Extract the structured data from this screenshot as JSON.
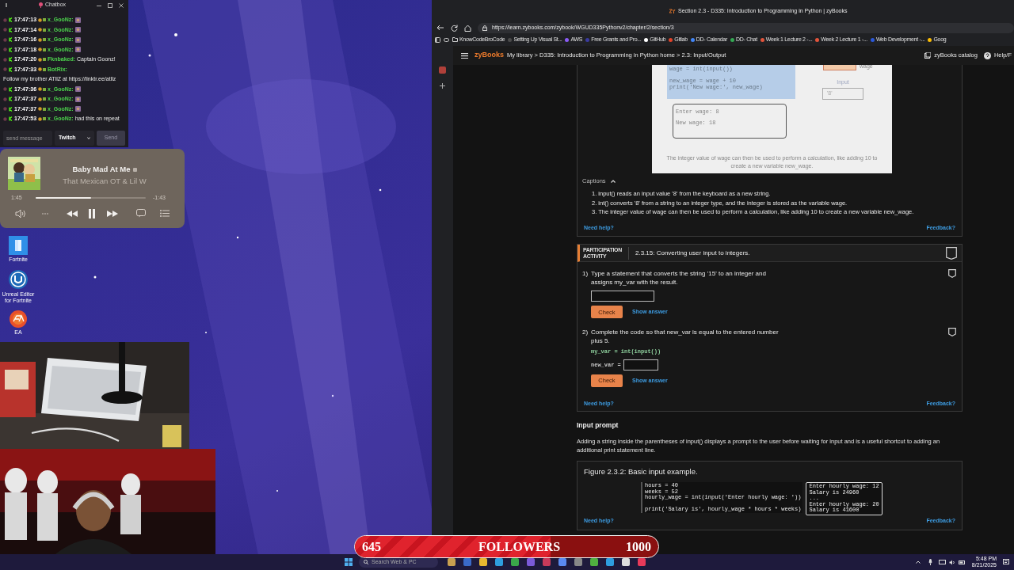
{
  "chat": {
    "title": "Chatbox",
    "messages": [
      {
        "time": "17:47:13",
        "user": "x_GooNz:",
        "emote": true
      },
      {
        "time": "17:47:14",
        "user": "x_GooNz:",
        "emote": true
      },
      {
        "time": "17:47:16",
        "user": "x_GooNz:",
        "emote": true
      },
      {
        "time": "17:47:18",
        "user": "x_GooNz:",
        "emote": true
      },
      {
        "time": "17:47:20",
        "user": "Fknbaked:",
        "text": "Captain Goonz!",
        "emote": false
      },
      {
        "time": "17:47:33",
        "user": "BotRix:",
        "text": "Follow my brother ATllZ at https://linktr.ee/atllz",
        "emote": false
      },
      {
        "time": "17:47:36",
        "user": "x_GooNz:",
        "emote": true
      },
      {
        "time": "17:47:37",
        "user": "x_GooNz:",
        "emote": true
      },
      {
        "time": "17:47:37",
        "user": "x_GooNz:",
        "emote": true
      },
      {
        "time": "17:47:53",
        "user": "x_GooNz:",
        "text": "had this on repeat",
        "emote": false
      }
    ],
    "input": {
      "placeholder": "send message"
    },
    "platform": "Twitch",
    "send_button": "Send"
  },
  "music": {
    "title": "Baby Mad At Me",
    "artist": "That Mexican OT & Lil W",
    "elapsed": "1:45",
    "remaining": "-1:43",
    "level": 0.5,
    "playing": true
  },
  "desktop_icons": [
    {
      "label": "Fortnite",
      "kind": "fortnite"
    },
    {
      "label": "Unreal Editor for Fortnite",
      "kind": "unreal"
    },
    {
      "label": "EA",
      "kind": "ea"
    }
  ],
  "browser": {
    "tab_title": "Section 2.3 - D335: Introduction to Programming in Python | zyBooks",
    "url": "https://learn.zybooks.com/zybook/WGUD335Pythonv2/chapter/2/section/3",
    "bookmarks": [
      {
        "label": "KnowCodeBroCode",
        "kind": "folder"
      },
      {
        "label": "Setting Up Visual St...",
        "kind": "site",
        "color": "#4a4a4a"
      },
      {
        "label": "AWS",
        "kind": "site",
        "color": "#8b5cf6"
      },
      {
        "label": "Free Grants and Pro...",
        "kind": "site",
        "color": "#3b3b9f"
      },
      {
        "label": "GitHub",
        "kind": "site",
        "color": "#ffffff"
      },
      {
        "label": "Gitlab",
        "kind": "site",
        "color": "#e24329"
      },
      {
        "label": "DD- Calendar",
        "kind": "site",
        "color": "#4285f4"
      },
      {
        "label": "DD- Chat",
        "kind": "site",
        "color": "#34a853"
      },
      {
        "label": "Week 1 Lecture 2 -...",
        "kind": "site",
        "color": "#e2543b"
      },
      {
        "label": "Week 2 Lecture 1 -...",
        "kind": "site",
        "color": "#e2543b"
      },
      {
        "label": "Web Development -...",
        "kind": "site",
        "color": "#2b58d8"
      },
      {
        "label": "Goog",
        "kind": "site",
        "color": "#fbbc05"
      }
    ]
  },
  "zybooks": {
    "logo": "zyBooks",
    "breadcrumb": "My library > D335: Introduction to Programming in Python home > 2.3: Input/Output",
    "catalog": "zyBooks catalog",
    "help": "Help/F",
    "animation": {
      "code_lines": [
        {
          "text": "wage = int(input())",
          "gap_before": false
        },
        {
          "text": "new_wage = wage + 10",
          "gap_before": true
        },
        {
          "text": "print('New wage:', new_wage)",
          "gap_before": false
        }
      ],
      "output_lines": [
        "Enter wage: 8",
        "New wage: 18"
      ],
      "memory_label": "wage",
      "input_label": "Input",
      "input_value": "'8'",
      "caption": "The integer value of wage can then be used to perform a calculation, like adding 10 to create a new variable new_wage."
    },
    "captions": {
      "label": "Captions",
      "expanded": true,
      "items": [
        "1. input() reads an input value '8' from the keyboard as a new string.",
        "2. int() converts '8' from a string to an integer type, and the integer is stored as the variable wage.",
        "3. The integer value of wage can then be used to perform a calculation, like adding 10 to create a new variable new_wage."
      ],
      "need_help": "Need help?",
      "feedback": "Feedback?"
    },
    "activity": {
      "label_lines": [
        "PARTICIPATION",
        "ACTIVITY"
      ],
      "title": "2.3.15: Converting user input to integers.",
      "completed": false,
      "questions": [
        {
          "number": "1)",
          "kind": "statement",
          "prompt": "Type a statement that converts the string '15' to an integer and assigns my_var with the result.",
          "completed": false,
          "check": "Check",
          "show_answer": "Show answer"
        },
        {
          "number": "2)",
          "kind": "code",
          "prompt": "Complete the code so that new_var is equal to the entered number plus 5.",
          "code_line": "my_var = int(input())",
          "blank_prefix": "new_var =",
          "completed": false,
          "check": "Check",
          "show_answer": "Show answer"
        }
      ],
      "need_help": "Need help?",
      "feedback": "Feedback?"
    },
    "section": {
      "heading": "Input prompt",
      "paragraph": "Adding a string inside the parentheses of input() displays a prompt to the user before waiting for input and is a useful shortcut to adding an additional print statement line.",
      "figure": {
        "caption": "Figure 2.3.2: Basic input example.",
        "code_lines": [
          {
            "text": "hours = 40",
            "gap_before": false
          },
          {
            "text": "weeks = 52",
            "gap_before": false
          },
          {
            "text": "hourly_wage = int(input('Enter hourly wage: '))",
            "gap_before": false
          },
          {
            "text": "print('Salary is', hourly_wage * hours * weeks)",
            "gap_before": true
          }
        ],
        "output_lines": [
          "Enter hourly wage: 12",
          "Salary is 24960",
          "...",
          "Enter hourly wage: 20",
          "Salary is 41600"
        ],
        "need_help": "Need help?",
        "feedback": "Feedback?"
      }
    }
  },
  "followers": {
    "count": "645",
    "label": "FOLLOWERS",
    "goal": "1000",
    "level": 0.645
  },
  "taskbar": {
    "search_placeholder": "Search Web & PC",
    "time": "5:48 PM",
    "date": "8/21/2025"
  }
}
